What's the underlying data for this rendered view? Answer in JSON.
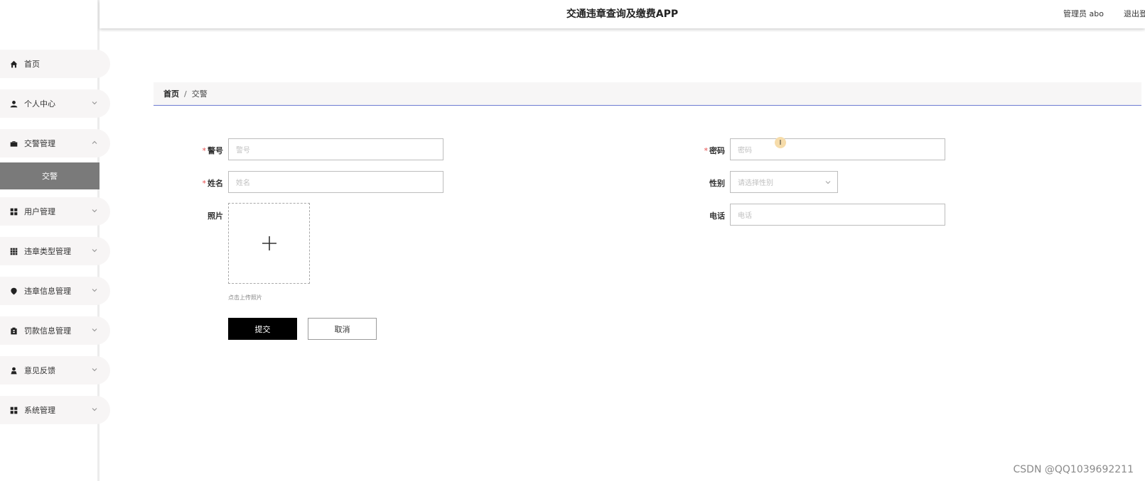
{
  "header": {
    "title": "交通违章查询及缴费APP",
    "admin_label": "管理员 abo",
    "logout_label": "退出登录"
  },
  "sidebar": {
    "items": [
      {
        "label": "首页",
        "icon": "home-icon",
        "expandable": false
      },
      {
        "label": "个人中心",
        "icon": "user-icon",
        "expandable": true
      },
      {
        "label": "交警管理",
        "icon": "briefcase-icon",
        "expandable": true,
        "expanded": true
      },
      {
        "label": "用户管理",
        "icon": "grid-icon",
        "expandable": true
      },
      {
        "label": "违章类型管理",
        "icon": "apps-icon",
        "expandable": true
      },
      {
        "label": "违章信息管理",
        "icon": "location-icon",
        "expandable": true
      },
      {
        "label": "罚款信息管理",
        "icon": "clipboard-icon",
        "expandable": true
      },
      {
        "label": "意见反馈",
        "icon": "person-icon",
        "expandable": true
      },
      {
        "label": "系统管理",
        "icon": "grid-icon",
        "expandable": true
      }
    ],
    "active_sub_item": "交警"
  },
  "breadcrumb": {
    "home": "首页",
    "separator": "/",
    "current": "交警"
  },
  "form": {
    "badge_number": {
      "label": "警号",
      "placeholder": "警号",
      "required": true
    },
    "password": {
      "label": "密码",
      "placeholder": "密码",
      "required": true
    },
    "name": {
      "label": "姓名",
      "placeholder": "姓名",
      "required": true
    },
    "gender": {
      "label": "性别",
      "placeholder": "请选择性别",
      "required": false
    },
    "photo": {
      "label": "照片",
      "hint": "点击上传照片"
    },
    "phone": {
      "label": "电话",
      "placeholder": "电话",
      "required": false
    },
    "submit_label": "提交",
    "cancel_label": "取消",
    "required_mark": "*"
  },
  "cursor_glyph": "I",
  "watermark": "CSDN @QQ1039692211"
}
